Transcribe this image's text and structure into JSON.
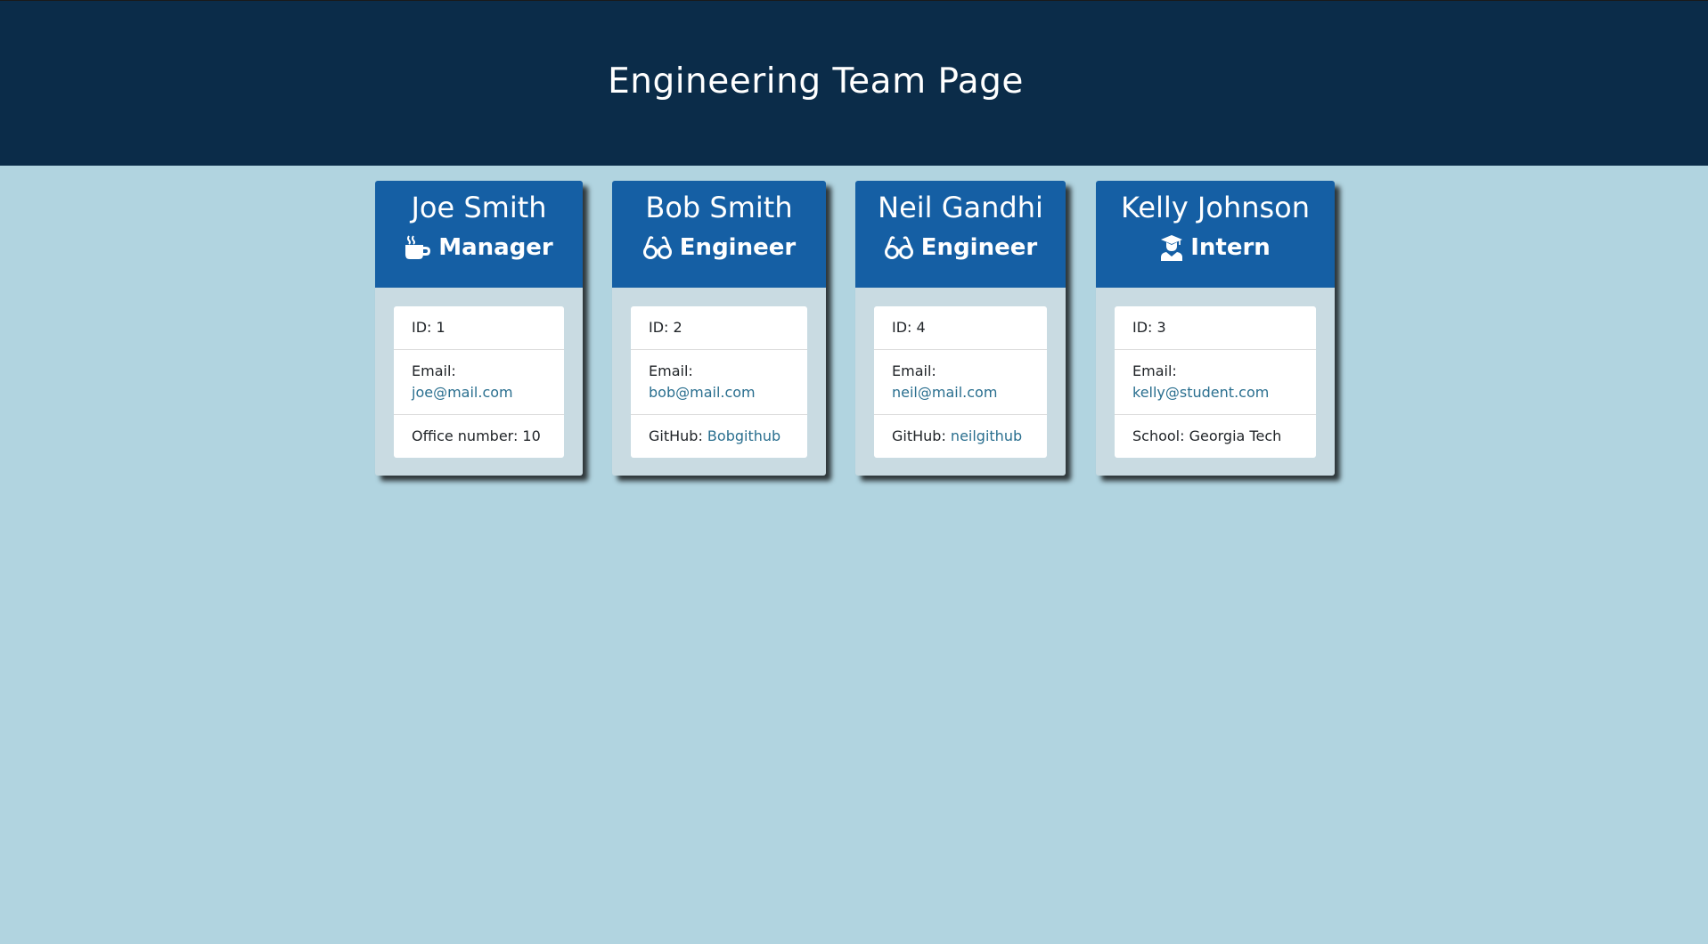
{
  "header": {
    "title": "Engineering Team Page"
  },
  "colors": {
    "page_background": "#b1d4e0",
    "header_background": "#0b2c49",
    "card_header": "#155fa4",
    "card_body": "#c9dbe2",
    "link": "#2a6f8f"
  },
  "cards": [
    {
      "name": "Joe Smith",
      "role": "Manager",
      "icon": "mug-hot-icon",
      "id_label": "ID: 1",
      "email_label": "Email:",
      "email": "joe@mail.com",
      "extra_label": "Office number: 10",
      "extra_link": ""
    },
    {
      "name": "Bob Smith",
      "role": "Engineer",
      "icon": "glasses-icon",
      "id_label": "ID: 2",
      "email_label": "Email:",
      "email": "bob@mail.com",
      "extra_label": "GitHub:",
      "extra_link": "Bobgithub"
    },
    {
      "name": "Neil Gandhi",
      "role": "Engineer",
      "icon": "glasses-icon",
      "id_label": "ID: 4",
      "email_label": "Email:",
      "email": "neil@mail.com",
      "extra_label": "GitHub:",
      "extra_link": "neilgithub"
    },
    {
      "name": "Kelly Johnson",
      "role": "Intern",
      "icon": "graduate-icon",
      "id_label": "ID: 3",
      "email_label": "Email:",
      "email": "kelly@student.com",
      "extra_label": "School: Georgia Tech",
      "extra_link": ""
    }
  ]
}
